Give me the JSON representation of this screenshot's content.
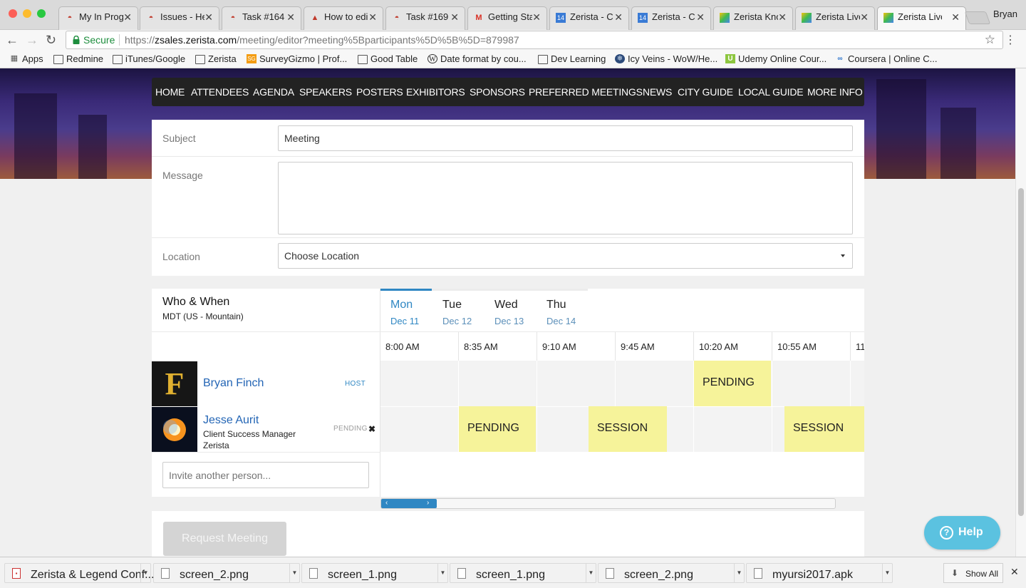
{
  "browser": {
    "profile": "Bryan",
    "tabs": [
      {
        "label": "My In Prog",
        "icon": "redmine-icon"
      },
      {
        "label": "Issues - He",
        "icon": "redmine-icon"
      },
      {
        "label": "Task #164",
        "icon": "redmine-icon"
      },
      {
        "label": "How to edi",
        "icon": "warning-icon"
      },
      {
        "label": "Task #169",
        "icon": "redmine-icon"
      },
      {
        "label": "Getting Sta",
        "icon": "gmail-icon"
      },
      {
        "label": "Zerista - C",
        "icon": "calendar-icon"
      },
      {
        "label": "Zerista - C",
        "icon": "calendar-icon"
      },
      {
        "label": "Zerista Kno",
        "icon": "zerista-icon"
      },
      {
        "label": "Zerista Live",
        "icon": "zerista-icon"
      },
      {
        "label": "Zerista Live",
        "icon": "zerista-icon"
      }
    ],
    "calendar_glyph": "14",
    "secure_label": "Secure",
    "url_scheme": "https://",
    "url_host": "zsales.zerista.com",
    "url_path": "/meeting/editor?meeting%5Bparticipants%5D%5B%5D=879987",
    "bookmarks": [
      {
        "label": "Apps",
        "icon": "apps-icon"
      },
      {
        "label": "Redmine",
        "icon": "folder-icon"
      },
      {
        "label": "iTunes/Google",
        "icon": "folder-icon"
      },
      {
        "label": "Zerista",
        "icon": "folder-icon"
      },
      {
        "label": "SurveyGizmo | Prof...",
        "icon": "surveygizmo-icon"
      },
      {
        "label": "Good Table",
        "icon": "folder-icon"
      },
      {
        "label": "Date format by cou...",
        "icon": "wikipedia-icon"
      },
      {
        "label": "Dev Learning",
        "icon": "folder-icon"
      },
      {
        "label": "Icy Veins - WoW/He...",
        "icon": "icyveins-icon"
      },
      {
        "label": "Udemy Online Cour...",
        "icon": "udemy-icon"
      },
      {
        "label": "Coursera | Online C...",
        "icon": "coursera-icon"
      }
    ]
  },
  "nav": {
    "items": [
      "HOME",
      "ATTENDEES",
      "AGENDA",
      "SPEAKERS",
      "POSTERS",
      "EXHIBITORS",
      "SPONSORS",
      "PREFERRED MEETINGS",
      "NEWS",
      "CITY GUIDE",
      "LOCAL GUIDE",
      "MORE INFO"
    ]
  },
  "form": {
    "subject_label": "Subject",
    "subject_value": "Meeting",
    "message_label": "Message",
    "message_value": "",
    "location_label": "Location",
    "location_value": "Choose Location"
  },
  "schedule": {
    "title": "Who & When",
    "timezone": "MDT (US - Mountain)",
    "days": [
      {
        "name": "Mon",
        "date": "Dec 11",
        "active": true
      },
      {
        "name": "Tue",
        "date": "Dec 12",
        "active": false
      },
      {
        "name": "Wed",
        "date": "Dec 13",
        "active": false
      },
      {
        "name": "Thu",
        "date": "Dec 14",
        "active": false
      }
    ],
    "times": [
      "8:00 AM",
      "8:35 AM",
      "9:10 AM",
      "9:45 AM",
      "10:20 AM",
      "10:55 AM",
      "11"
    ],
    "participants": [
      {
        "name": "Bryan Finch",
        "role": "",
        "company": "",
        "status": "HOST",
        "avatar": "pirates-logo-avatar"
      },
      {
        "name": "Jesse Aurit",
        "role": "Client Success Manager",
        "company": "Zerista",
        "status": "PENDING",
        "avatar": "explosion-avatar"
      }
    ],
    "slots": {
      "host_pending": "PENDING",
      "guest_pending": "PENDING",
      "guest_session_1": "SESSION",
      "guest_session_2": "SESSION"
    },
    "invite_placeholder": "Invite another person...",
    "scroll_left": "‹",
    "scroll_right": "›"
  },
  "actions": {
    "request_label": "Request Meeting",
    "help_label": "Help",
    "help_glyph": "?"
  },
  "downloads": {
    "items": [
      {
        "name": "Zerista & Legend Conf....pdf",
        "type": "pdf"
      },
      {
        "name": "screen_2.png",
        "type": "png"
      },
      {
        "name": "screen_1.png",
        "type": "png"
      },
      {
        "name": "screen_1.png",
        "type": "png"
      },
      {
        "name": "screen_2.png",
        "type": "png"
      },
      {
        "name": "myursi2017.apk",
        "type": "apk"
      }
    ],
    "show_all": "Show All"
  },
  "colors": {
    "accent": "#2f87c3",
    "slot_yellow": "#f6f39a",
    "help_bg": "#5bc2e0",
    "nav_bg": "#222222"
  }
}
